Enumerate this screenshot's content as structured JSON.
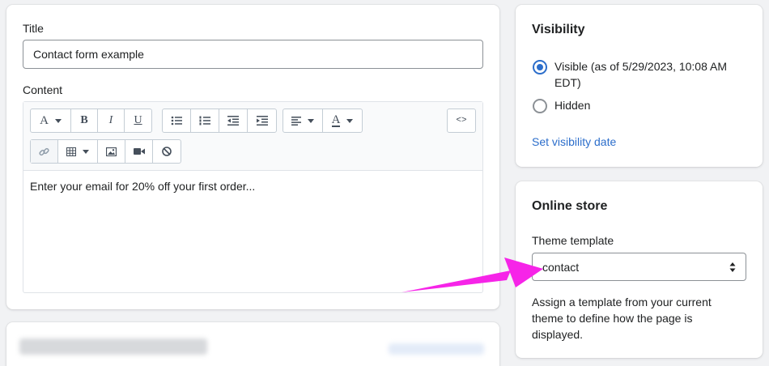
{
  "main": {
    "title_label": "Title",
    "title_value": "Contact form example",
    "content_label": "Content",
    "toolbar": {
      "text_style_icon": "A",
      "bold_icon": "B",
      "italic_icon": "I",
      "underline_icon": "U",
      "html_icon": "<>",
      "text_color_icon": "A"
    },
    "editor_text": "Enter your email for 20% off your first order..."
  },
  "visibility": {
    "heading": "Visibility",
    "options": [
      {
        "label": "Visible (as of 5/29/2023, 10:08 AM EDT)",
        "checked": true
      },
      {
        "label": "Hidden",
        "checked": false
      }
    ],
    "set_date_link": "Set visibility date"
  },
  "online_store": {
    "heading": "Online store",
    "theme_label": "Theme template",
    "theme_value": "contact",
    "help_text": "Assign a template from your current theme to define how the page is displayed."
  },
  "colors": {
    "accent": "#2c6ecb",
    "annotation_arrow": "#f624e8"
  }
}
